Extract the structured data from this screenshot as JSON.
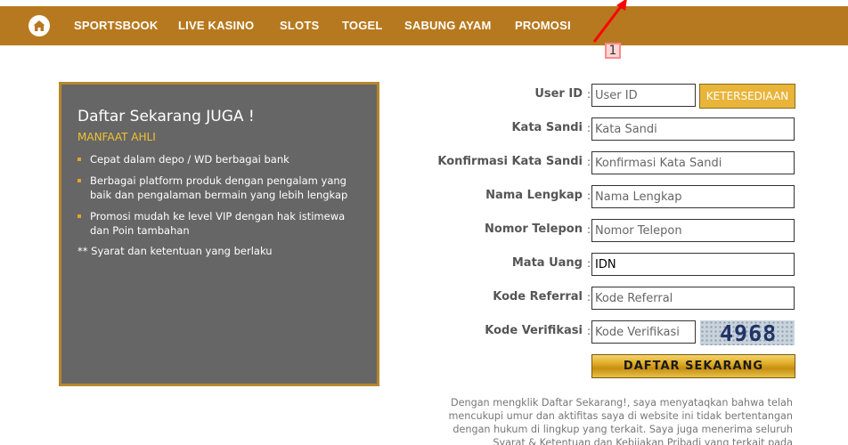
{
  "nav": {
    "items": [
      "SPORTSBOOK",
      "LIVE KASINO",
      "SLOTS",
      "TOGEL",
      "SABUNG AYAM",
      "PROMOSI"
    ]
  },
  "annotation": {
    "badge": "1",
    "color": "#ff0000"
  },
  "promo": {
    "title": "Daftar Sekarang JUGA !",
    "subtitle": "MANFAAT AHLI",
    "benefits": [
      "Cepat dalam depo / WD berbagai bank",
      "Berbagai platform produk dengan pengalam yang baik dan pengalaman bermain yang lebih lengkap",
      "Promosi mudah ke level VIP dengan hak istimewa dan Poin tambahan"
    ],
    "note": "** Syarat dan ketentuan yang berlaku"
  },
  "form": {
    "user_id": {
      "label": "User ID",
      "placeholder": "User ID"
    },
    "availability_button": "KETERSEDIAAN",
    "password": {
      "label": "Kata Sandi",
      "placeholder": "Kata Sandi"
    },
    "confirm_password": {
      "label": "Konfirmasi Kata Sandi",
      "placeholder": "Konfirmasi Kata Sandi"
    },
    "full_name": {
      "label": "Nama Lengkap",
      "placeholder": "Nama Lengkap"
    },
    "phone": {
      "label": "Nomor Telepon",
      "placeholder": "Nomor Telepon"
    },
    "currency": {
      "label": "Mata Uang",
      "value": "IDN"
    },
    "referral": {
      "label": "Kode Referral",
      "placeholder": "Kode Referral"
    },
    "verification": {
      "label": "Kode Verifikasi",
      "placeholder": "Kode Verifikasi",
      "captcha": "4968"
    },
    "colon": ":",
    "submit_button": "DAFTAR SEKARANG"
  },
  "disclaimer": "Dengan mengklik Daftar Sekarang!, saya menyataqkan bahwa telah mencukupi umur dan aktifitas saya di website ini tidak bertentangan dengan hukum di lingkup yang terkait. Saya juga menerima seluruh Syarat & Ketentuan dan Kebijakan Pribadi yang terkait pada pengajuan",
  "colors": {
    "nav_bg": "#b7791f",
    "promo_bg": "#666666",
    "promo_border": "#b7862b",
    "accent": "#e8b53a"
  }
}
